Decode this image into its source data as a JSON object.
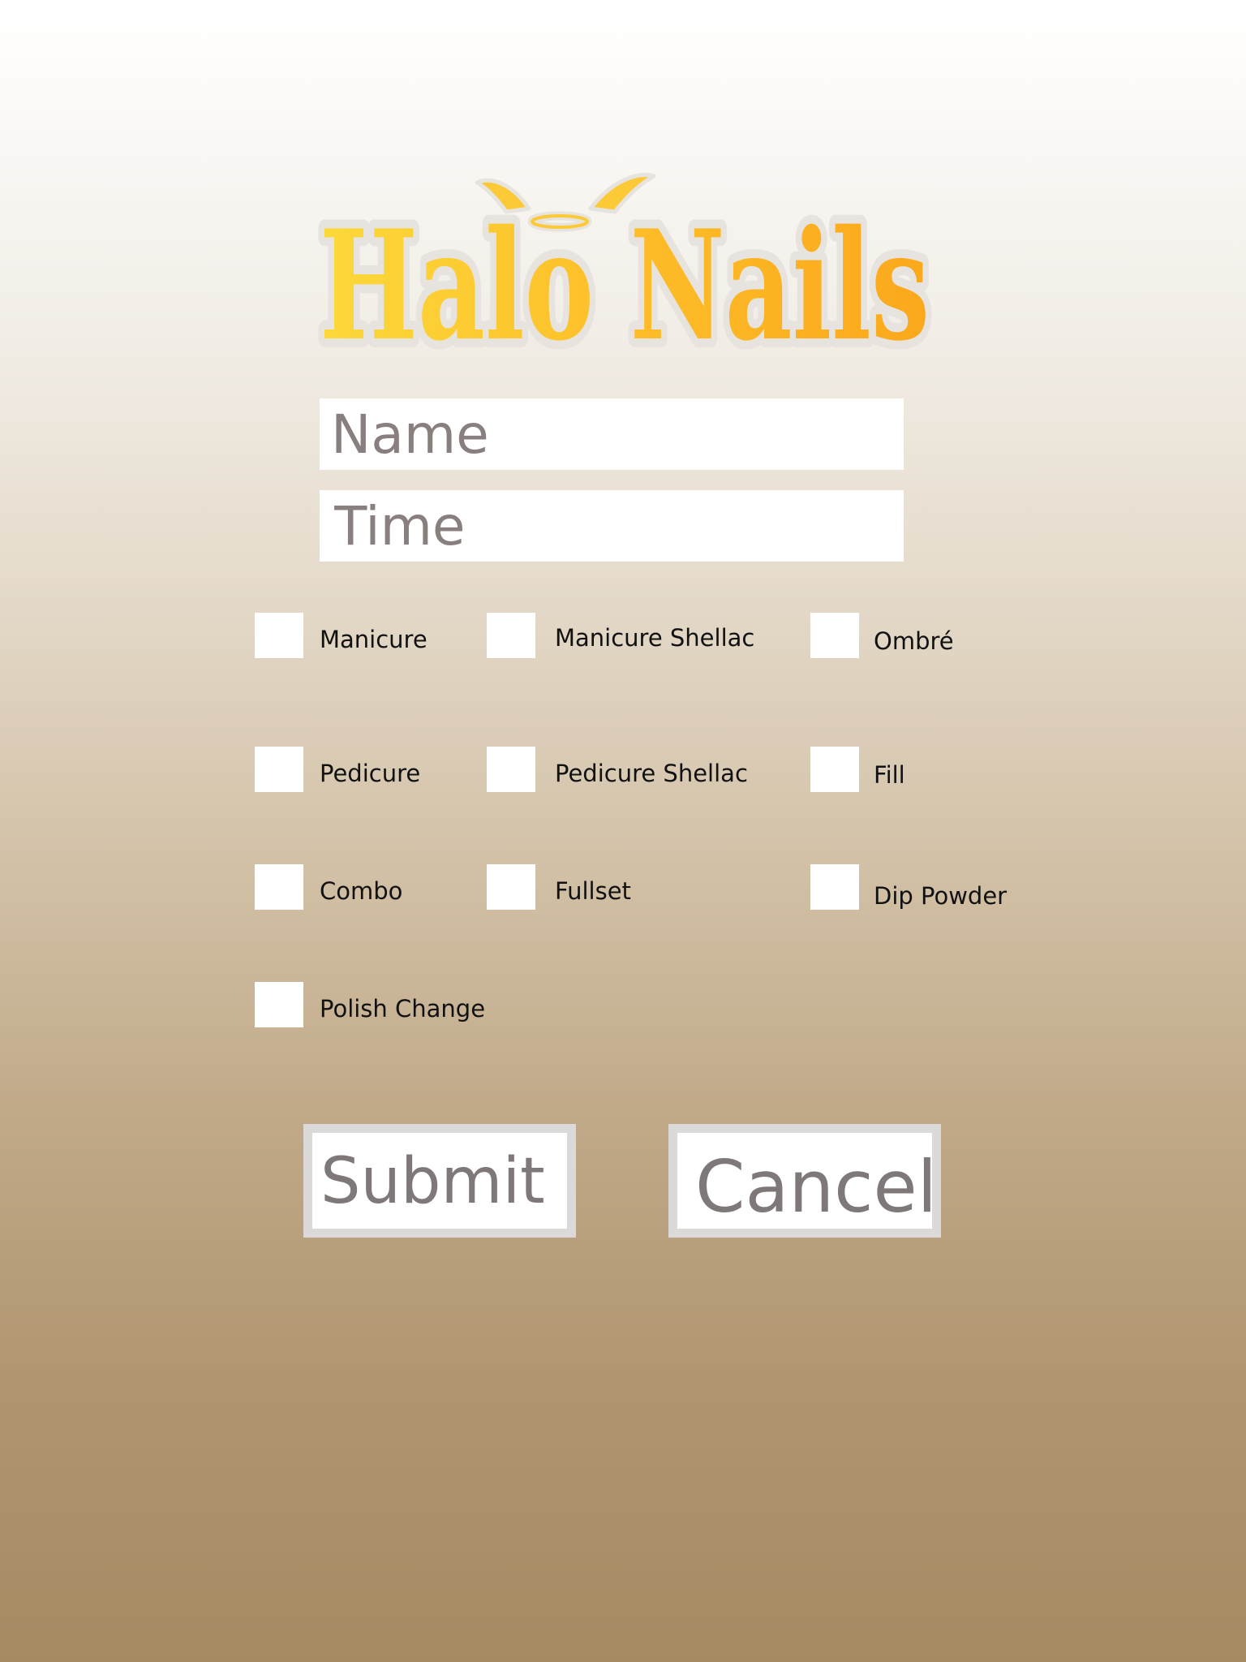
{
  "brand": {
    "logo_text": "Halo Nails",
    "colors": {
      "logo_yellow": "#fbd434",
      "logo_orange": "#fba81c",
      "outline": "#e7e3df"
    }
  },
  "form": {
    "name_placeholder": "Name",
    "name_value": "",
    "time_placeholder": "Time",
    "time_value": ""
  },
  "services": [
    {
      "label": "Manicure",
      "checked": false
    },
    {
      "label": "Manicure Shellac",
      "checked": false
    },
    {
      "label": "Ombré",
      "checked": false
    },
    {
      "label": "Pedicure",
      "checked": false
    },
    {
      "label": "Pedicure Shellac",
      "checked": false
    },
    {
      "label": "Fill",
      "checked": false
    },
    {
      "label": "Combo",
      "checked": false
    },
    {
      "label": "Fullset",
      "checked": false
    },
    {
      "label": "Dip Powder",
      "checked": false
    },
    {
      "label": "Polish Change",
      "checked": false
    }
  ],
  "actions": {
    "submit_label": "Submit",
    "cancel_label": "Cancel"
  },
  "theme": {
    "gradient_top": "#ffffff",
    "gradient_bottom": "#a58b62",
    "button_border": "#dcdad8",
    "button_text": "#7f7878"
  }
}
